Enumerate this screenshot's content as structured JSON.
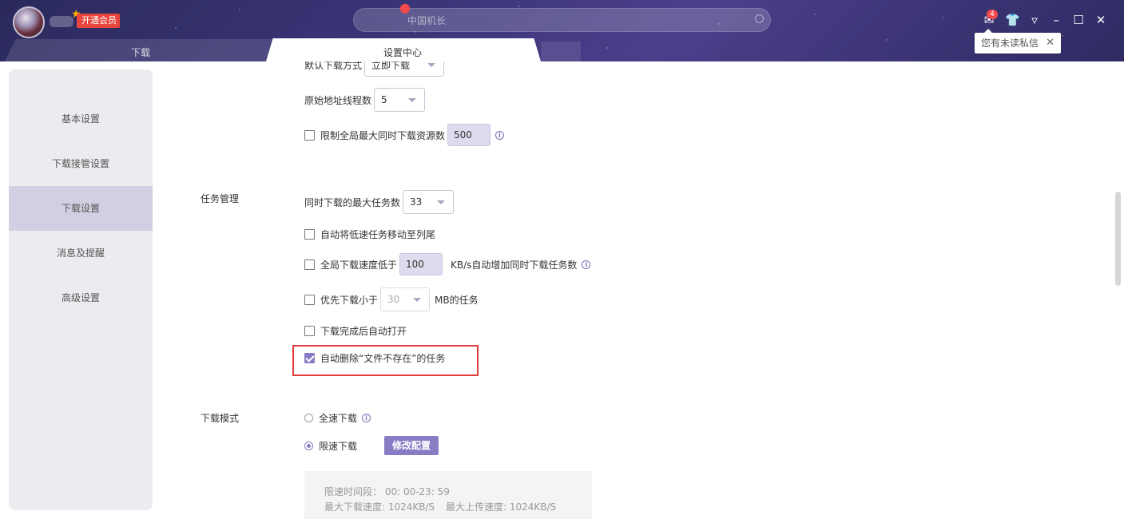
{
  "header": {
    "vip_label": "开通会员",
    "search_placeholder": "中国机长",
    "message_count": "4",
    "tooltip": "您有未读私信"
  },
  "tabs": [
    {
      "label": "下载"
    },
    {
      "label": "设置中心"
    }
  ],
  "sidebar": {
    "items": [
      {
        "label": "基本设置"
      },
      {
        "label": "下载接管设置"
      },
      {
        "label": "下载设置"
      },
      {
        "label": "消息及提醒"
      },
      {
        "label": "高级设置"
      }
    ],
    "active": "下载设置"
  },
  "settings": {
    "default_mode_label": "默认下载方式",
    "default_mode_value": "立即下载",
    "origin_threads_label": "原始地址线程数",
    "origin_threads_value": "5",
    "limit_global_label": "限制全局最大同时下载资源数",
    "limit_global_value": "500",
    "task_section": "任务管理",
    "max_tasks_label": "同时下载的最大任务数",
    "max_tasks_value": "33",
    "move_slow_label": "自动将低速任务移动至列尾",
    "speed_below_label": "全局下载速度低于",
    "speed_below_value": "100",
    "speed_below_suffix": "KB/s自动增加同时下载任务数",
    "priority_small_label": "优先下载小于",
    "priority_small_value": "30",
    "priority_small_suffix": "MB的任务",
    "auto_open_label": "下载完成后自动打开",
    "auto_delete_label": "自动删除“文件不存在”的任务",
    "mode_section": "下载模式",
    "full_speed_label": "全速下载",
    "limited_speed_label": "限速下载",
    "modify_config_label": "修改配置",
    "limit_period": "限速时间段： 00: 00-23: 59",
    "limit_max_download": "最大下载速度: 1024KB/S",
    "limit_max_upload": "最大上传速度: 1024KB/S"
  },
  "state": {
    "limit_global_checked": false,
    "move_slow_checked": false,
    "speed_below_checked": false,
    "priority_small_checked": false,
    "auto_open_checked": false,
    "auto_delete_checked": true,
    "download_mode": "限速下载"
  },
  "colors": {
    "accent": "#8a7cc4",
    "header_bg": "#3a3577",
    "highlight": "#e23b3b"
  }
}
